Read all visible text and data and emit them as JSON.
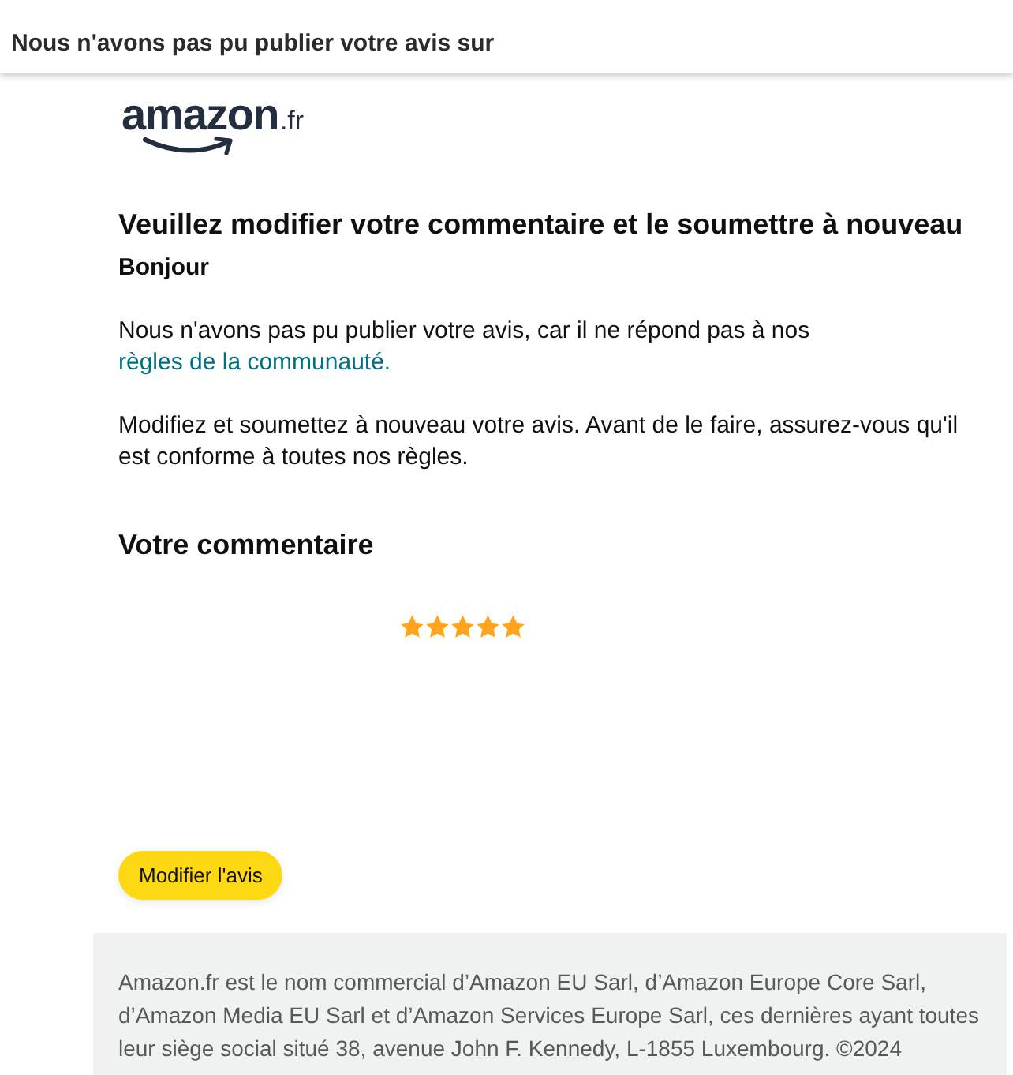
{
  "header": {
    "title": "Nous n'avons pas pu publier votre avis sur"
  },
  "logo": {
    "text": "amazon",
    "suffix": ".fr"
  },
  "message": {
    "heading": "Veuillez modifier votre commentaire et le soumettre à nouveau",
    "greeting": "Bonjour",
    "paragraphs": [
      {
        "text": "Nous n'avons pas pu publier votre avis, car il ne répond pas à nos",
        "link": "règles de la communauté."
      },
      {
        "text": "Modifiez et soumettez à nouveau votre avis. Avant de le faire, assurez-vous qu'il est conforme à toutes nos règles."
      }
    ]
  },
  "review": {
    "heading": "Votre commentaire",
    "stars": 5
  },
  "button": {
    "label": "Modifier l'avis"
  },
  "footer": {
    "text": "Amazon.fr est le nom commercial d’Amazon EU Sarl, d’Amazon Europe Core Sarl, d’Amazon Media EU Sarl et d’Amazon Services Europe Sarl, ces dernières ayant toutes leur siège social situé 38, avenue John F. Kennedy, L-1855 Luxembourg. ©2024"
  }
}
